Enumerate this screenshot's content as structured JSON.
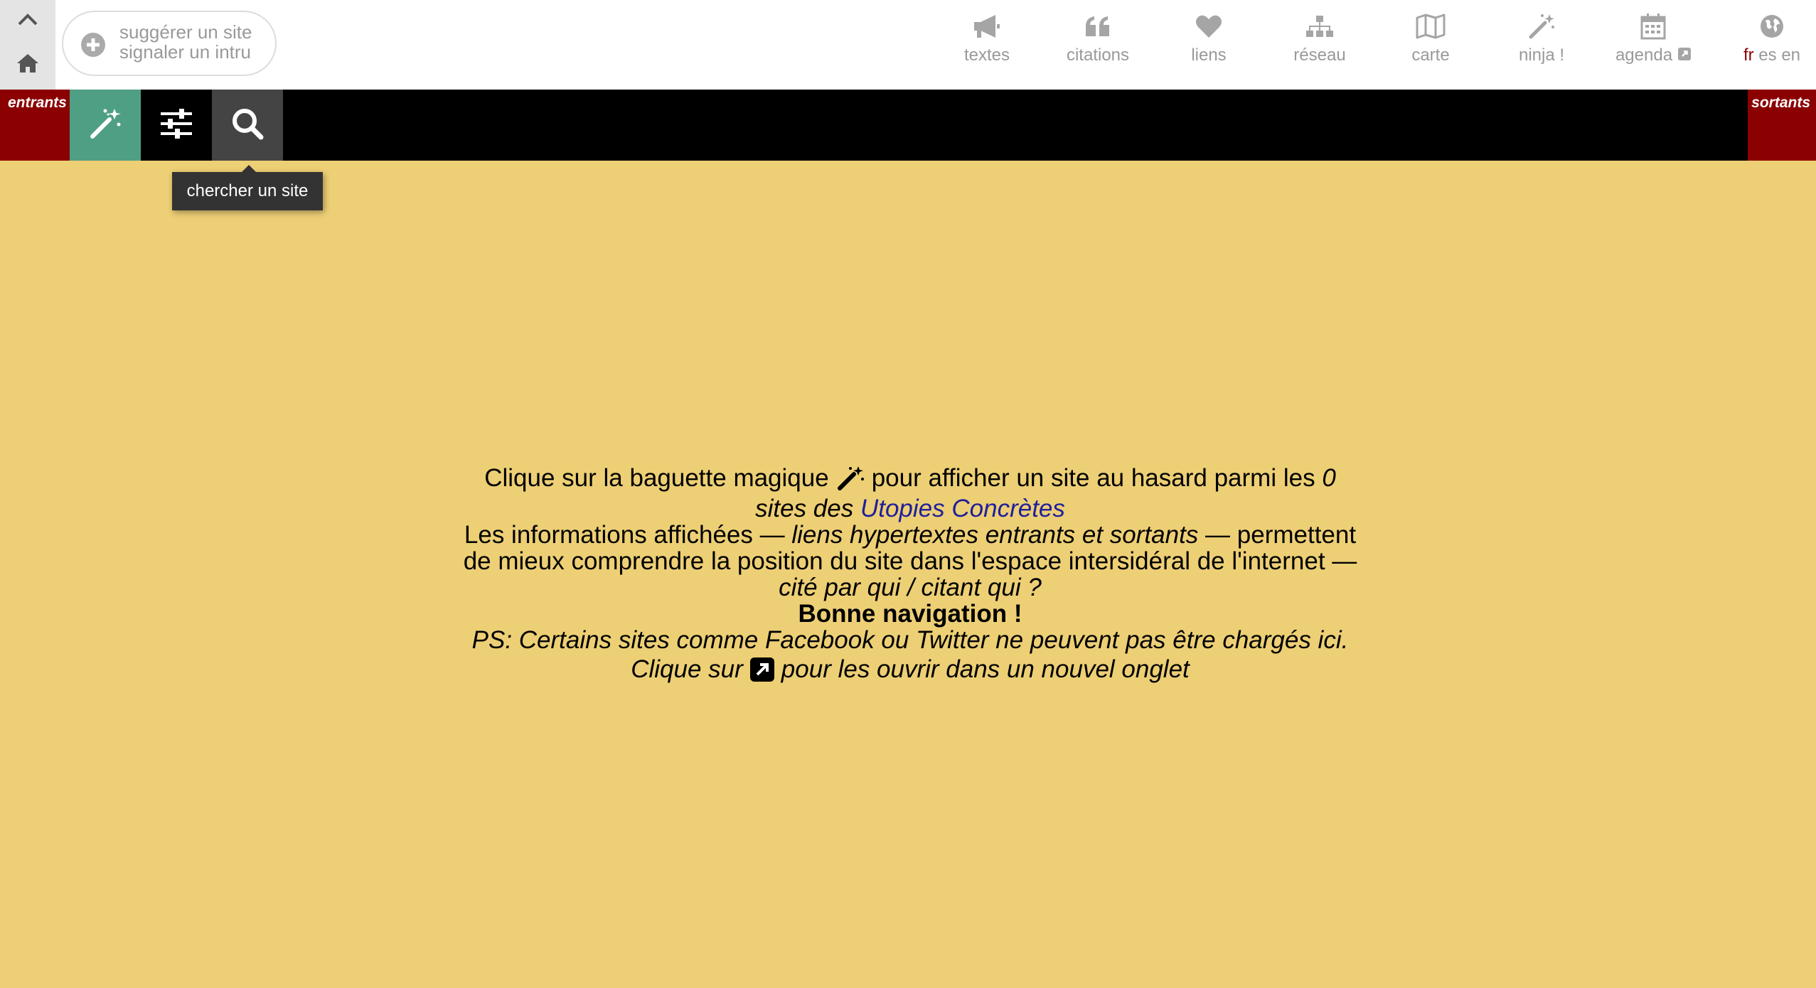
{
  "header": {
    "suggest": {
      "line1": "suggérer un site",
      "line2": "signaler un intru"
    },
    "nav": [
      {
        "icon": "megaphone-icon",
        "label": "textes"
      },
      {
        "icon": "quote-icon",
        "label": "citations"
      },
      {
        "icon": "heart-icon",
        "label": "liens"
      },
      {
        "icon": "sitemap-icon",
        "label": "réseau"
      },
      {
        "icon": "map-icon",
        "label": "carte"
      },
      {
        "icon": "magic-wand-icon",
        "label": "ninja !"
      },
      {
        "icon": "calendar-icon",
        "label": "agenda",
        "external_icon": "external-link-icon"
      }
    ],
    "languages": {
      "icon": "globe-icon",
      "active": "fr",
      "others": [
        "es",
        "en"
      ]
    }
  },
  "toolbar": {
    "incoming_label": "entrants",
    "outgoing_label": "sortants",
    "tooltip": "chercher un site",
    "colors": {
      "tag_bg": "#8B0000",
      "wand_bg": "#4f9f84",
      "search_bg": "#444444"
    }
  },
  "main": {
    "l1a": "Clique sur la baguette magique",
    "l1b": "pour afficher un site au hasard parmi les",
    "l1c": "0",
    "l2a": "sites des",
    "l2link": "Utopies Concrètes",
    "l3a": "Les informations affichées —",
    "l3b": "liens hypertextes entrants et sortants",
    "l3c": "— permettent",
    "l4": "de mieux comprendre la position du site dans l'espace intersidéral de l'internet —",
    "l5": "cité par qui / citant qui ?",
    "l6": "Bonne navigation !",
    "l7": "PS: Certains sites comme Facebook ou Twitter ne peuvent pas être chargés ici.",
    "l8a": "Clique sur",
    "l8b": "pour les ouvrir dans un nouvel onglet"
  },
  "colors": {
    "background": "#EDCF75",
    "link": "#1f1f9c"
  }
}
